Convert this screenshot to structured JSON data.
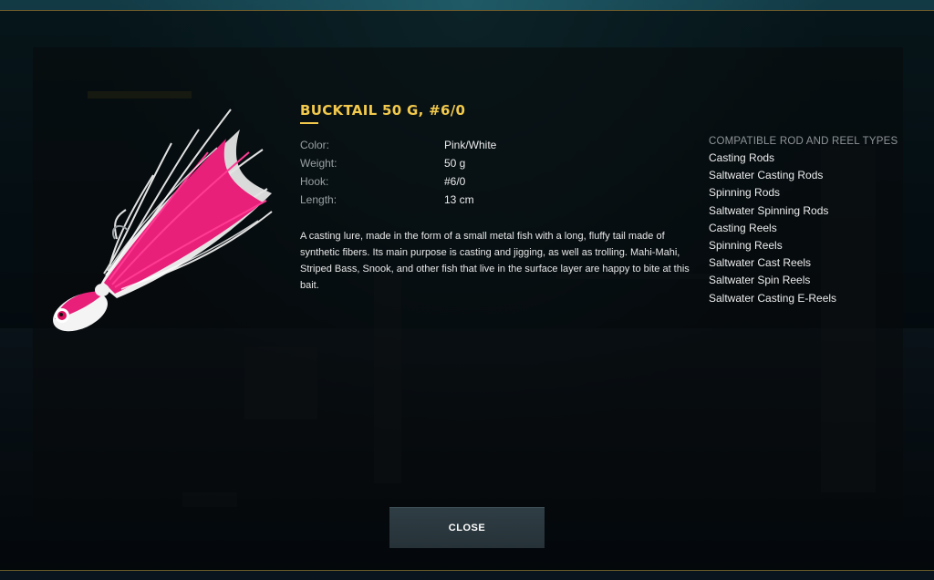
{
  "item": {
    "title": "BUCKTAIL 50 G, #6/0",
    "image_icon": "bucktail-lure-pink-white"
  },
  "properties": [
    {
      "label": "Color:",
      "value": "Pink/White"
    },
    {
      "label": "Weight:",
      "value": "50 g"
    },
    {
      "label": "Hook:",
      "value": "#6/0"
    },
    {
      "label": "Length:",
      "value": "13 cm"
    }
  ],
  "description": "A casting lure, made in the form of a small metal fish with a long, fluffy tail made of synthetic fibers. Its main purpose is casting and jigging, as well as trolling. Mahi-Mahi, Striped Bass, Snook, and other fish that live in the surface layer are happy to bite at this bait.",
  "compatible": {
    "heading": "COMPATIBLE ROD AND REEL TYPES",
    "items": [
      "Casting Rods",
      "Saltwater Casting Rods",
      "Spinning Rods",
      "Saltwater Spinning Rods",
      "Casting Reels",
      "Spinning Reels",
      "Saltwater Cast Reels",
      "Saltwater Spin Reels",
      "Saltwater Casting E-Reels"
    ]
  },
  "buttons": {
    "close": "CLOSE"
  },
  "colors": {
    "accent": "#f2c94c",
    "lure_pink": "#e8207a",
    "lure_white": "#f4f4f4",
    "button_bg": "#2b3a41"
  }
}
